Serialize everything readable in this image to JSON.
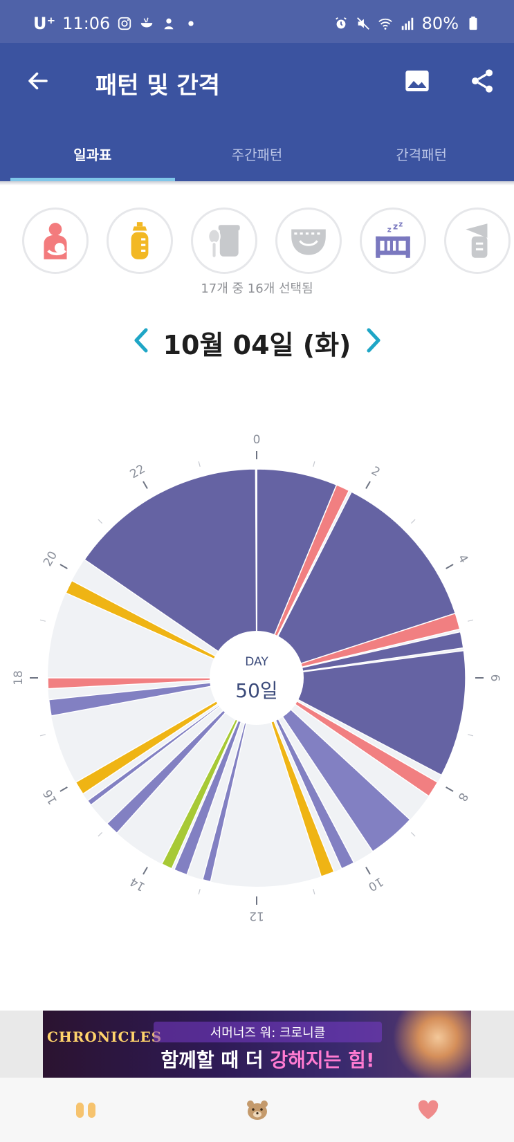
{
  "status_bar": {
    "carrier": "U⁺",
    "time": "11:06",
    "battery": "80%"
  },
  "app_bar": {
    "title": "패턴 및 간격"
  },
  "tabs": [
    {
      "label": "일과표",
      "active": true
    },
    {
      "label": "주간패턴",
      "active": false
    },
    {
      "label": "간격패턴",
      "active": false
    }
  ],
  "filters": {
    "items": [
      {
        "name": "breastfeeding",
        "color": "#f37b7d"
      },
      {
        "name": "bottle",
        "color": "#f2b824"
      },
      {
        "name": "baby-food",
        "color": "#c7c9cc"
      },
      {
        "name": "diaper",
        "color": "#c7c9cc"
      },
      {
        "name": "sleep",
        "color": "#7a78bf"
      },
      {
        "name": "pumping",
        "color": "#c7c9cc"
      }
    ],
    "count_text": "17개 중 16개 선택됨"
  },
  "date": {
    "label": "10월 04일 (화)"
  },
  "chart_data": {
    "type": "pie",
    "center_label_top": "DAY",
    "center_label_bottom": "50일",
    "hour_ticks": [
      "0",
      "2",
      "4",
      "6",
      "8",
      "10",
      "12",
      "14",
      "16",
      "18",
      "20",
      "22"
    ],
    "colors": {
      "sleep": "#6563a3",
      "sleep_light": "#8280c2",
      "breastfeeding": "#f17f81",
      "bottle": "#efb414",
      "baby_food": "#a7c935",
      "empty": "#f0f2f5"
    },
    "segments": [
      {
        "type": "sleep",
        "start": 0.0,
        "end": 1.5
      },
      {
        "type": "breastfeeding",
        "start": 1.5,
        "end": 1.75
      },
      {
        "type": "sleep",
        "start": 1.8,
        "end": 4.8
      },
      {
        "type": "breastfeeding",
        "start": 4.8,
        "end": 5.1
      },
      {
        "type": "sleep",
        "start": 5.15,
        "end": 5.45
      },
      {
        "type": "sleep",
        "start": 5.5,
        "end": 7.85
      },
      {
        "type": "breastfeeding",
        "start": 8.0,
        "end": 8.3
      },
      {
        "type": "sleep_light",
        "start": 8.85,
        "end": 9.75
      },
      {
        "type": "sleep_light",
        "start": 10.15,
        "end": 10.4
      },
      {
        "type": "bottle",
        "start": 10.55,
        "end": 10.8
      },
      {
        "type": "sleep_light",
        "start": 12.85,
        "end": 13.0
      },
      {
        "type": "sleep_light",
        "start": 13.3,
        "end": 13.55
      },
      {
        "type": "baby_food",
        "start": 13.6,
        "end": 13.8
      },
      {
        "type": "sleep_light",
        "start": 14.8,
        "end": 15.05
      },
      {
        "type": "sleep_light",
        "start": 15.5,
        "end": 15.6
      },
      {
        "type": "bottle",
        "start": 15.75,
        "end": 16.0
      },
      {
        "type": "sleep_light",
        "start": 17.3,
        "end": 17.6
      },
      {
        "type": "breastfeeding",
        "start": 17.8,
        "end": 18.0
      },
      {
        "type": "bottle",
        "start": 19.6,
        "end": 19.85
      },
      {
        "type": "sleep",
        "start": 20.3,
        "end": 23.98
      }
    ]
  },
  "ad": {
    "brand": "CHRONICLES",
    "line1": "서머너즈 워: 크로니클",
    "line2_pre": "함께할 때 더 ",
    "line2_hl": "강해지는 힘!"
  },
  "bottom_nav": [
    {
      "name": "record",
      "color": "#f6c36e"
    },
    {
      "name": "baby",
      "color": "#c49a6c"
    },
    {
      "name": "favorites",
      "color": "#ef8a8a"
    }
  ]
}
